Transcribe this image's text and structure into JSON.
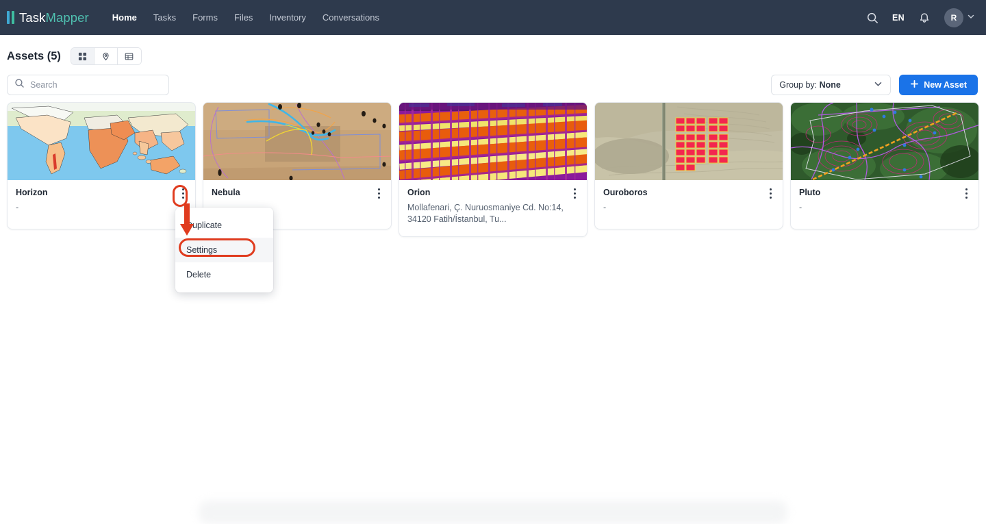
{
  "header": {
    "logo": {
      "part1": "Task",
      "part2": "Mapper",
      "icon": "logo-bars-icon"
    },
    "nav": [
      {
        "label": "Home",
        "active": true
      },
      {
        "label": "Tasks",
        "active": false
      },
      {
        "label": "Forms",
        "active": false
      },
      {
        "label": "Files",
        "active": false
      },
      {
        "label": "Inventory",
        "active": false
      },
      {
        "label": "Conversations",
        "active": false
      }
    ],
    "search_icon": "search-icon",
    "language": "EN",
    "bell_icon": "bell-icon",
    "avatar_initial": "R",
    "chevron_icon": "chevron-down-icon"
  },
  "page": {
    "title": "Assets (5)",
    "views": [
      {
        "name": "grid-view",
        "icon": "grid-icon",
        "active": true
      },
      {
        "name": "map-view",
        "icon": "map-pin-icon",
        "active": false
      },
      {
        "name": "table-view",
        "icon": "table-icon",
        "active": false
      }
    ]
  },
  "toolbar": {
    "search_placeholder": "Search",
    "search_value": "",
    "group_by_prefix": "Group by: ",
    "group_by_value": "None",
    "new_asset_label": "New Asset",
    "plus_icon": "plus-icon"
  },
  "assets": [
    {
      "title": "Horizon",
      "subtitle": "-",
      "thumb": "world-heatmap"
    },
    {
      "title": "Nebula",
      "subtitle": "-",
      "thumb": "desert-survey-lines"
    },
    {
      "title": "Orion",
      "subtitle": "Mollafenari, Ç. Nuruosmaniye Cd. No:14, 34120 Fatih/İstanbul, Tu...",
      "thumb": "thermal-solar-panels"
    },
    {
      "title": "Ouroboros",
      "subtitle": "-",
      "thumb": "desert-plot-grid"
    },
    {
      "title": "Pluto",
      "subtitle": "-",
      "thumb": "terrain-contours"
    }
  ],
  "context_menu": {
    "items": [
      {
        "label": "Duplicate",
        "highlighted": false
      },
      {
        "label": "Settings",
        "highlighted": true
      },
      {
        "label": "Delete",
        "highlighted": false
      }
    ]
  },
  "annotation": {
    "color": "#e03c1f"
  }
}
